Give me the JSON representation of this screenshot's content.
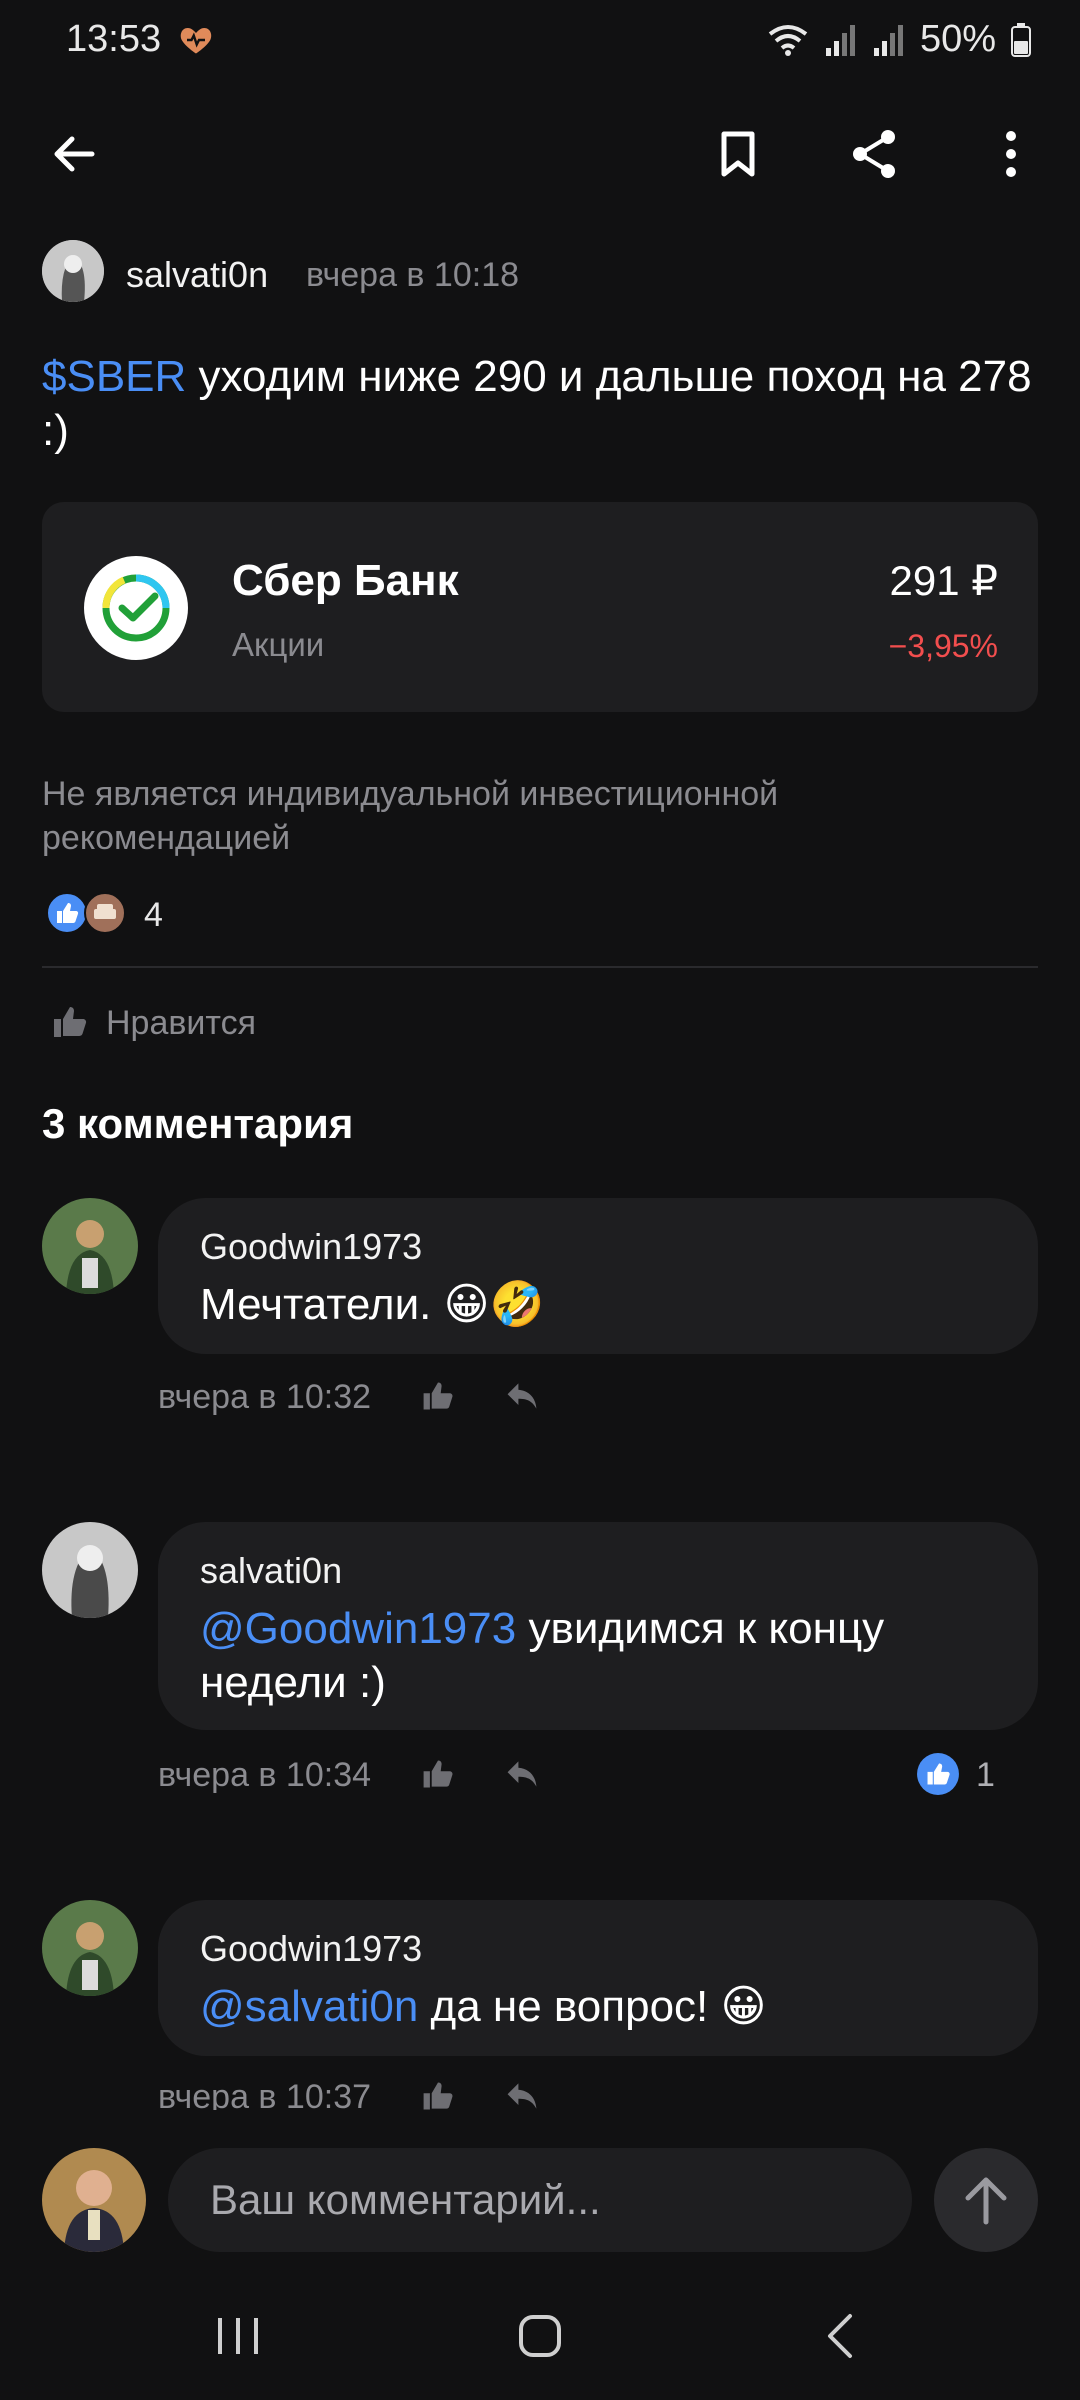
{
  "status_bar": {
    "time": "13:53",
    "battery": "50%"
  },
  "post": {
    "author": "salvati0n",
    "time": "вчера в 10:18",
    "ticker": "$SBER",
    "text": " уходим ниже 290 и дальше поход на 278 :)",
    "stock": {
      "name": "Сбер Банк",
      "type": "Акции",
      "price": "291 ₽",
      "change": "−3,95%"
    },
    "disclaimer": "Не является индивидуальной инвестиционной рекомендацией",
    "reactions_count": "4",
    "like_label": "Нравится"
  },
  "comments_title": "3 комментария",
  "comments": [
    {
      "author": "Goodwin1973",
      "mention": "",
      "text": "Мечтатели. 😀🤣",
      "time": "вчера в 10:32",
      "likes": ""
    },
    {
      "author": "salvati0n",
      "mention": "@Goodwin1973",
      "text": " увидимся к концу недели :)",
      "time": "вчера в 10:34",
      "likes": "1"
    },
    {
      "author": "Goodwin1973",
      "mention": "@salvati0n",
      "text": " да не вопрос! 😀",
      "time": "вчера в 10:37",
      "likes": ""
    }
  ],
  "input": {
    "placeholder": "Ваш комментарий..."
  },
  "colors": {
    "background": "#111112",
    "card": "#1e1e20",
    "accent": "#4a8ef5",
    "negative": "#f24e4e",
    "muted": "#8b8b90"
  }
}
